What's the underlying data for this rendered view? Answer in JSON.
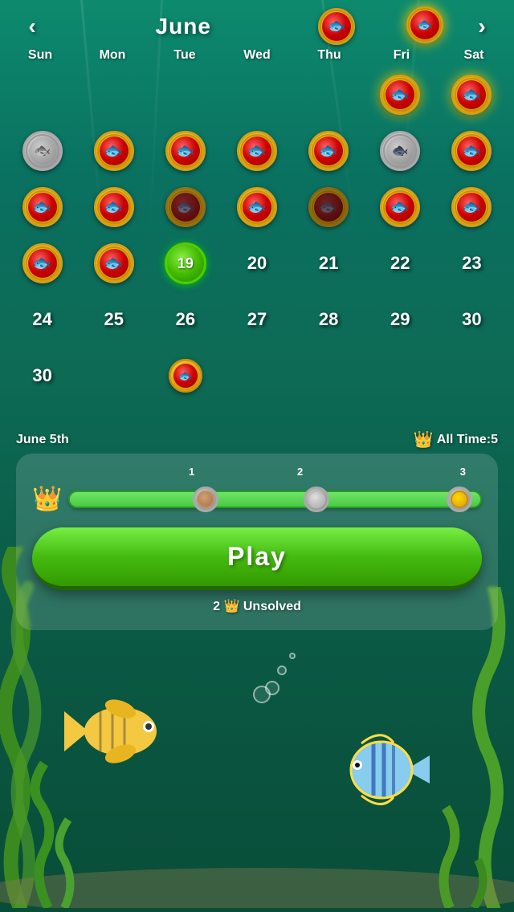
{
  "header": {
    "prev_label": "‹",
    "next_label": "›",
    "month": "June"
  },
  "day_headers": [
    "Sun",
    "Mon",
    "Tue",
    "Wed",
    "Thu",
    "Fri",
    "Sat"
  ],
  "calendar": {
    "rows": [
      [
        {
          "type": "empty",
          "day": ""
        },
        {
          "type": "empty",
          "day": ""
        },
        {
          "type": "empty",
          "day": ""
        },
        {
          "type": "empty",
          "day": ""
        },
        {
          "type": "empty",
          "day": ""
        },
        {
          "type": "coin_gold_edge",
          "day": ""
        },
        {
          "type": "coin_gold_edge",
          "day": ""
        }
      ],
      [
        {
          "type": "coin_silver",
          "day": ""
        },
        {
          "type": "coin_gold",
          "day": ""
        },
        {
          "type": "coin_gold",
          "day": ""
        },
        {
          "type": "coin_gold",
          "day": ""
        },
        {
          "type": "coin_gold",
          "day": ""
        },
        {
          "type": "coin_silver_blue",
          "day": ""
        },
        {
          "type": "coin_gold",
          "day": ""
        }
      ],
      [
        {
          "type": "coin_gold",
          "day": ""
        },
        {
          "type": "coin_gold",
          "day": ""
        },
        {
          "type": "coin_gold_dark",
          "day": ""
        },
        {
          "type": "coin_gold",
          "day": ""
        },
        {
          "type": "coin_gold_dark",
          "day": ""
        },
        {
          "type": "coin_gold",
          "day": ""
        },
        {
          "type": "coin_gold",
          "day": ""
        }
      ],
      [
        {
          "type": "coin_gold",
          "day": ""
        },
        {
          "type": "coin_gold",
          "day": ""
        },
        {
          "type": "coin_green",
          "day": "19"
        },
        {
          "type": "number",
          "day": "20"
        },
        {
          "type": "number",
          "day": "21"
        },
        {
          "type": "number",
          "day": "22"
        },
        {
          "type": "number",
          "day": "23"
        }
      ],
      [
        {
          "type": "number",
          "day": "24"
        },
        {
          "type": "number",
          "day": "25"
        },
        {
          "type": "number",
          "day": "26"
        },
        {
          "type": "number",
          "day": "27"
        },
        {
          "type": "number",
          "day": "28"
        },
        {
          "type": "number",
          "day": "29"
        },
        {
          "type": "number",
          "day": "30"
        }
      ],
      [
        {
          "type": "number",
          "day": "30"
        },
        {
          "type": "empty",
          "day": ""
        },
        {
          "type": "coin_gold_sm",
          "day": ""
        },
        {
          "type": "empty",
          "day": ""
        },
        {
          "type": "empty",
          "day": ""
        },
        {
          "type": "empty",
          "day": ""
        },
        {
          "type": "empty",
          "day": ""
        }
      ]
    ]
  },
  "info": {
    "date_label": "June 5th",
    "all_time_label": "All Time:",
    "all_time_value": "5"
  },
  "progress": {
    "milestone_1": "1",
    "milestone_2": "2",
    "milestone_3": "3"
  },
  "play_button": {
    "label": "Play"
  },
  "unsolved": {
    "count": "2",
    "label": "Unsolved"
  }
}
